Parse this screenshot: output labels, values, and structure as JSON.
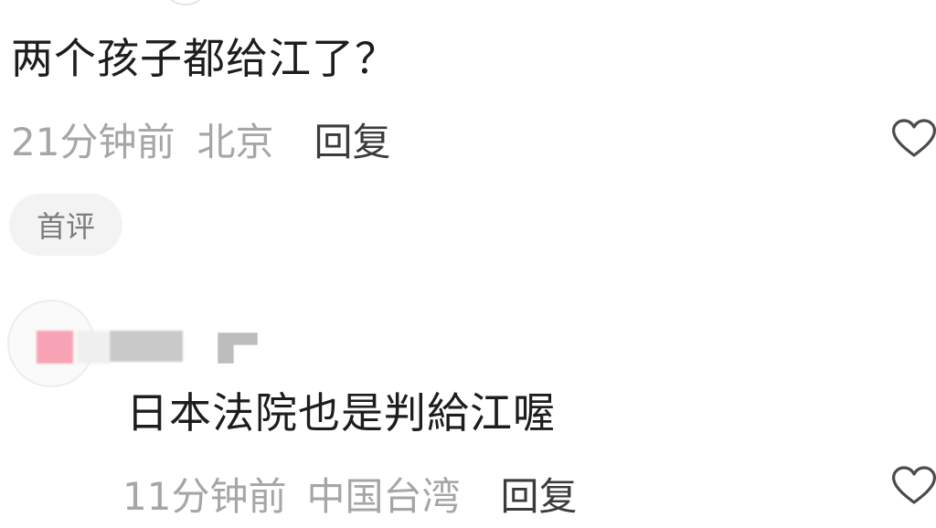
{
  "comment1": {
    "text": "两个孩子都给江了？",
    "time": "21分钟前",
    "location": "北京",
    "reply_label": "回复",
    "badge": "首评"
  },
  "comment2": {
    "text": "日本法院也是判給江喔",
    "time": "11分钟前",
    "location": "中国台湾",
    "reply_label": "回复"
  },
  "icons": {
    "like": "heart-outline-icon"
  },
  "colors": {
    "text": "#1d1d1d",
    "meta": "#a6a6a6",
    "badge_bg": "#f3f3f3",
    "badge_text": "#7c7c7c",
    "avatar_blur_pink": "#f7a3b5"
  }
}
